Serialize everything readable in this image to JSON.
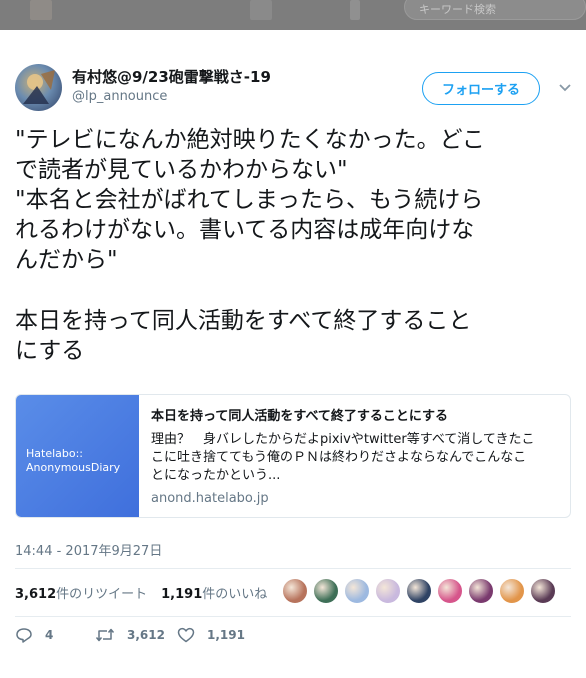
{
  "background": {
    "search_placeholder": "キーワード検索"
  },
  "tweet": {
    "author": {
      "display_name": "有村悠@9/23砲雷撃戦さ-19",
      "handle": "@lp_announce"
    },
    "follow_label": "フォローする",
    "text_lines": [
      "\"テレビになんか絶対映りたくなかった。どこ",
      "で読者が見ているかわからない\"",
      "\"本名と会社がばれてしまったら、もう続けら",
      "れるわけがない。書いてる内容は成年向けな",
      "んだから\"",
      "",
      "本日を持って同人活動をすべて終了すること",
      "にする"
    ],
    "link_card": {
      "thumb_line1": "Hatelabo::",
      "thumb_line2": "AnonymousDiary",
      "title": "本日を持って同人活動をすべて終了することにする",
      "desc_lines": [
        "理由？　身バレしたからだよpixivやtwitter等すべて消してきたこ",
        "こに吐き捨ててもう俺のＰＮは終わりださよならなんでこんなこ",
        "とになったかという..."
      ],
      "domain": "anond.hatelabo.jp"
    },
    "timestamp": "14:44 - 2017年9月27日",
    "stats": {
      "retweets_count": "3,612",
      "retweets_label": "件のリツイート",
      "likes_count": "1,191",
      "likes_label": "件のいいね"
    },
    "liker_colors": [
      "#b7735c",
      "#3e6f57",
      "#9db9e0",
      "#c9b9de",
      "#2f4364",
      "#d6558b",
      "#7a3a6e",
      "#e2954a",
      "#5a3b55"
    ],
    "actions": {
      "reply_count": "4",
      "retweet_count": "3,612",
      "like_count": "1,191"
    },
    "accent_color": "#1da1f2"
  }
}
